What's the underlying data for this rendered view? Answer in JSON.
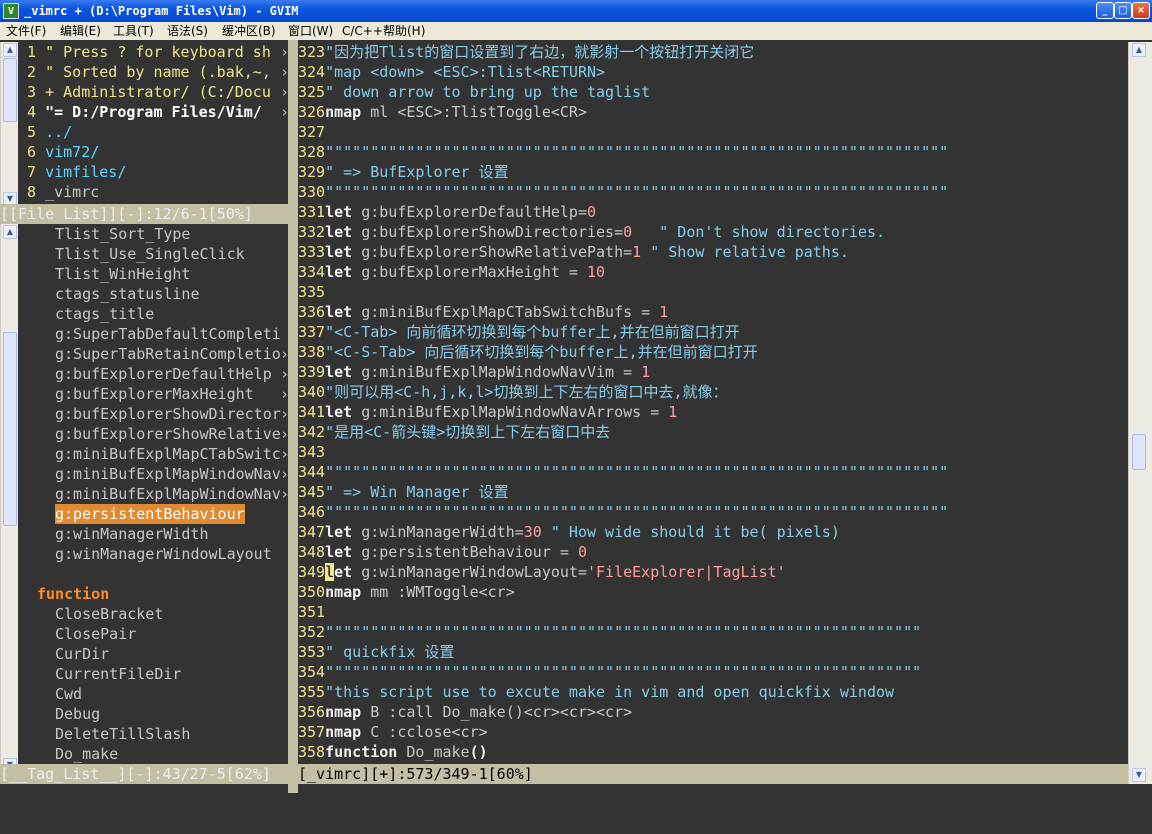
{
  "window": {
    "title": "_vimrc + (D:\\Program Files\\Vim) - GVIM",
    "app_icon": "vim-icon",
    "buttons": {
      "minimize": "_",
      "maximize": "□",
      "close": "×"
    }
  },
  "menu": [
    "文件(F)",
    "编辑(E)",
    "工具(T)",
    "语法(S)",
    "缓冲区(B)",
    "窗口(W)",
    "C/C++",
    "帮助(H)"
  ],
  "file_list": {
    "rows": [
      {
        "num": " 1",
        "text": " \" Press ? for keyboard sh"
      },
      {
        "num": " 2",
        "text": " \" Sorted by name (.bak,~,"
      },
      {
        "num": " 3",
        "text": " + Administrator/ (C:/Docu"
      },
      {
        "num": " 4",
        "text": " \"= D:/Program Files/Vim/"
      },
      {
        "num": " 5",
        "text": " ../"
      },
      {
        "num": " 6",
        "text": " vim72/"
      },
      {
        "num": " 7",
        "text": " vimfiles/"
      },
      {
        "num": " 8",
        "text": " _vimrc"
      }
    ],
    "status": "[[File List]][-]:12/6-1[50%]"
  },
  "tag_list": {
    "items": [
      "Tlist_Sort_Type",
      "Tlist_Use_SingleClick",
      "Tlist_WinHeight",
      "ctags_statusline",
      "ctags_title",
      "g:SuperTabDefaultCompleti",
      "g:SuperTabRetainCompletio",
      "g:bufExplorerDefaultHelp",
      "g:bufExplorerMaxHeight",
      "g:bufExplorerShowDirector",
      "g:bufExplorerShowRelative",
      "g:miniBufExplMapCTabSwitc",
      "g:miniBufExplMapWindowNav",
      "g:miniBufExplMapWindowNav",
      "g:persistentBehaviour",
      "g:winManagerWidth",
      "g:winManagerWindowLayout"
    ],
    "selected_item": "g:persistentBehaviour",
    "function_header": "function",
    "functions": [
      "CloseBracket",
      "ClosePair",
      "CurDir",
      "CurrentFileDir",
      "Cwd",
      "Debug",
      "DeleteTillSlash",
      "Do_make"
    ],
    "status": "[__Tag_List__][-]:43/27-5[62%]"
  },
  "editor": {
    "lines": [
      {
        "n": "323",
        "parts": [
          {
            "c": "cm",
            "t": "\"因为把Tlist的窗口设置到了右边，就影射一个按钮打开关闭它"
          }
        ]
      },
      {
        "n": "324",
        "parts": [
          {
            "c": "cm",
            "t": "\"map <down> <ESC>:Tlist<RETURN>"
          }
        ]
      },
      {
        "n": "325",
        "parts": [
          {
            "c": "cm",
            "t": "\" down arrow to bring up the taglist"
          }
        ]
      },
      {
        "n": "326",
        "parts": [
          {
            "c": "kw",
            "t": "nmap"
          },
          {
            "c": "gy",
            "t": " ml <ESC>:TlistToggle<CR>"
          }
        ]
      },
      {
        "n": "327",
        "parts": []
      },
      {
        "n": "328",
        "parts": [
          {
            "c": "cm",
            "t": "\"\"\"\"\"\"\"\"\"\"\"\"\"\"\"\"\"\"\"\"\"\"\"\"\"\"\"\"\"\"\"\"\"\"\"\"\"\"\"\"\"\"\"\"\"\"\"\"\"\"\"\"\"\"\"\"\"\"\"\"\"\"\"\"\"\"\"\"\""
          }
        ]
      },
      {
        "n": "329",
        "parts": [
          {
            "c": "cm",
            "t": "\" => BufExplorer 设置"
          }
        ]
      },
      {
        "n": "330",
        "parts": [
          {
            "c": "cm",
            "t": "\"\"\"\"\"\"\"\"\"\"\"\"\"\"\"\"\"\"\"\"\"\"\"\"\"\"\"\"\"\"\"\"\"\"\"\"\"\"\"\"\"\"\"\"\"\"\"\"\"\"\"\"\"\"\"\"\"\"\"\"\"\"\"\"\"\"\"\"\""
          }
        ]
      },
      {
        "n": "331",
        "parts": [
          {
            "c": "kw",
            "t": "let"
          },
          {
            "c": "gy",
            "t": " g:bufExplorerDefaultHelp="
          },
          {
            "c": "num",
            "t": "0"
          }
        ]
      },
      {
        "n": "332",
        "parts": [
          {
            "c": "kw",
            "t": "let"
          },
          {
            "c": "gy",
            "t": " g:bufExplorerShowDirectories="
          },
          {
            "c": "num",
            "t": "0"
          },
          {
            "c": "cm",
            "t": "   \" Don't show directories."
          }
        ]
      },
      {
        "n": "333",
        "parts": [
          {
            "c": "kw",
            "t": "let"
          },
          {
            "c": "gy",
            "t": " g:bufExplorerShowRelativePath="
          },
          {
            "c": "num",
            "t": "1"
          },
          {
            "c": "cm",
            "t": " \" Show relative paths."
          }
        ]
      },
      {
        "n": "334",
        "parts": [
          {
            "c": "kw",
            "t": "let"
          },
          {
            "c": "gy",
            "t": " g:bufExplorerMaxHeight = "
          },
          {
            "c": "num",
            "t": "10"
          }
        ]
      },
      {
        "n": "335",
        "parts": []
      },
      {
        "n": "336",
        "parts": [
          {
            "c": "kw",
            "t": "let"
          },
          {
            "c": "gy",
            "t": " g:miniBufExplMapCTabSwitchBufs = "
          },
          {
            "c": "num",
            "t": "1"
          }
        ]
      },
      {
        "n": "337",
        "parts": [
          {
            "c": "cm",
            "t": "\"<C-Tab> 向前循环切换到每个buffer上,并在但前窗口打开"
          }
        ]
      },
      {
        "n": "338",
        "parts": [
          {
            "c": "cm",
            "t": "\"<C-S-Tab> 向后循环切换到每个buffer上,并在但前窗口打开"
          }
        ]
      },
      {
        "n": "339",
        "parts": [
          {
            "c": "kw",
            "t": "let"
          },
          {
            "c": "gy",
            "t": " g:miniBufExplMapWindowNavVim = "
          },
          {
            "c": "num",
            "t": "1"
          }
        ]
      },
      {
        "n": "340",
        "parts": [
          {
            "c": "cm",
            "t": "\"则可以用<C-h,j,k,l>切换到上下左右的窗口中去,就像："
          }
        ]
      },
      {
        "n": "341",
        "parts": [
          {
            "c": "kw",
            "t": "let"
          },
          {
            "c": "gy",
            "t": " g:miniBufExplMapWindowNavArrows = "
          },
          {
            "c": "num",
            "t": "1"
          }
        ]
      },
      {
        "n": "342",
        "parts": [
          {
            "c": "cm",
            "t": "\"是用<C-箭头键>切换到上下左右窗口中去"
          }
        ]
      },
      {
        "n": "343",
        "parts": []
      },
      {
        "n": "344",
        "parts": [
          {
            "c": "cm",
            "t": "\"\"\"\"\"\"\"\"\"\"\"\"\"\"\"\"\"\"\"\"\"\"\"\"\"\"\"\"\"\"\"\"\"\"\"\"\"\"\"\"\"\"\"\"\"\"\"\"\"\"\"\"\"\"\"\"\"\"\"\"\"\"\"\"\"\"\"\"\""
          }
        ]
      },
      {
        "n": "345",
        "parts": [
          {
            "c": "cm",
            "t": "\" => Win Manager 设置"
          }
        ]
      },
      {
        "n": "346",
        "parts": [
          {
            "c": "cm",
            "t": "\"\"\"\"\"\"\"\"\"\"\"\"\"\"\"\"\"\"\"\"\"\"\"\"\"\"\"\"\"\"\"\"\"\"\"\"\"\"\"\"\"\"\"\"\"\"\"\"\"\"\"\"\"\"\"\"\"\"\"\"\"\"\"\"\"\"\"\"\""
          }
        ]
      },
      {
        "n": "347",
        "parts": [
          {
            "c": "kw",
            "t": "let"
          },
          {
            "c": "gy",
            "t": " g:winManagerWidth="
          },
          {
            "c": "num",
            "t": "30"
          },
          {
            "c": "cm",
            "t": " \" How wide should it be( pixels)"
          }
        ]
      },
      {
        "n": "348",
        "parts": [
          {
            "c": "kw",
            "t": "let"
          },
          {
            "c": "gy",
            "t": " g:persistentBehaviour = "
          },
          {
            "c": "num",
            "t": "0"
          }
        ]
      },
      {
        "n": "349",
        "parts": [
          {
            "c": "cursor",
            "t": "l"
          },
          {
            "c": "kw",
            "t": "et"
          },
          {
            "c": "gy",
            "t": " g:winManagerWindowLayout="
          },
          {
            "c": "str",
            "t": "'FileExplorer|TagList'"
          }
        ]
      },
      {
        "n": "350",
        "parts": [
          {
            "c": "kw",
            "t": "nmap"
          },
          {
            "c": "gy",
            "t": " mm :WMToggle<cr>"
          }
        ]
      },
      {
        "n": "351",
        "parts": []
      },
      {
        "n": "352",
        "parts": [
          {
            "c": "cm",
            "t": "\"\"\"\"\"\"\"\"\"\"\"\"\"\"\"\"\"\"\"\"\"\"\"\"\"\"\"\"\"\"\"\"\"\"\"\"\"\"\"\"\"\"\"\"\"\"\"\"\"\"\"\"\"\"\"\"\"\"\"\"\"\"\"\"\"\""
          }
        ]
      },
      {
        "n": "353",
        "parts": [
          {
            "c": "cm",
            "t": "\" quickfix 设置"
          }
        ]
      },
      {
        "n": "354",
        "parts": [
          {
            "c": "cm",
            "t": "\"\"\"\"\"\"\"\"\"\"\"\"\"\"\"\"\"\"\"\"\"\"\"\"\"\"\"\"\"\"\"\"\"\"\"\"\"\"\"\"\"\"\"\"\"\"\"\"\"\"\"\"\"\"\"\"\"\"\"\"\"\"\"\"\"\""
          }
        ]
      },
      {
        "n": "355",
        "parts": [
          {
            "c": "cm",
            "t": "\"this script use to excute make in vim and open quickfix window"
          }
        ]
      },
      {
        "n": "356",
        "parts": [
          {
            "c": "kw",
            "t": "nmap"
          },
          {
            "c": "gy",
            "t": " B :call Do_make()<cr><cr><cr>"
          }
        ]
      },
      {
        "n": "357",
        "parts": [
          {
            "c": "kw",
            "t": "nmap"
          },
          {
            "c": "gy",
            "t": " C :cclose<cr>"
          }
        ]
      },
      {
        "n": "358",
        "parts": [
          {
            "c": "kw",
            "t": "function"
          },
          {
            "c": "gy",
            "t": " Do_make"
          },
          {
            "c": "kw",
            "t": "()"
          }
        ]
      }
    ],
    "status": "[_vimrc][+]:573/349-1[60%]"
  },
  "colors": {
    "background": "#333333",
    "linenr": "#f0e68c",
    "comment": "#87ceeb",
    "selected": "#e08a32",
    "status_bg": "#c2bfa5"
  }
}
